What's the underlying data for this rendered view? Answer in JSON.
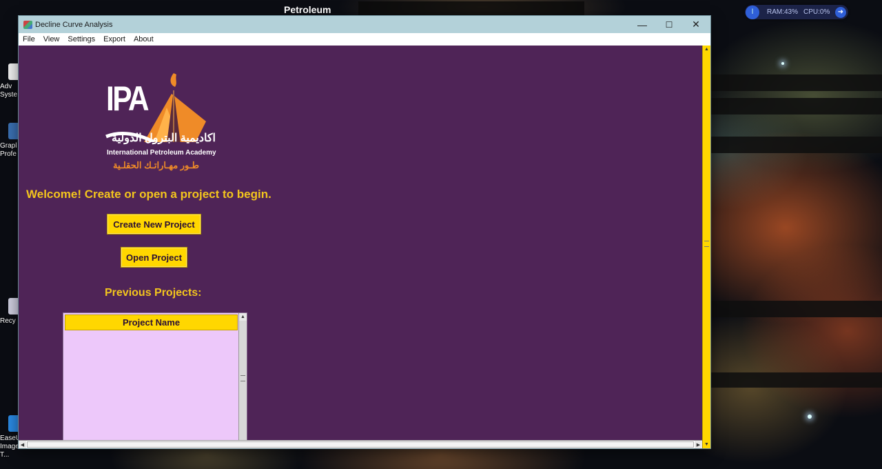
{
  "desktop": {
    "wallpaper_label": "Petroleum",
    "icons": [
      {
        "label": "Adv Syste"
      },
      {
        "label": "Grapl Profe"
      },
      {
        "label": "Recy"
      },
      {
        "label": "EaseUS Image T..."
      }
    ],
    "system_monitor": {
      "ram": "RAM:43%",
      "cpu": "CPU:0%"
    }
  },
  "window": {
    "title": "Decline Curve Analysis",
    "controls": {
      "minimize": "—",
      "maximize": "☐",
      "close": "✕"
    }
  },
  "menu": [
    "File",
    "View",
    "Settings",
    "Export",
    "About"
  ],
  "logo": {
    "mark": "IPA",
    "arabic_name": "اكاديمية البترول الدولية",
    "english_name": "International Petroleum Academy",
    "arabic_tagline": "طـور مهـاراتـك الحقلـية"
  },
  "welcome_text": "Welcome! Create or open a project to begin.",
  "buttons": {
    "create": "Create New Project",
    "open": "Open Project"
  },
  "previous_projects": {
    "heading": "Previous Projects:",
    "columns": [
      "Project Name"
    ],
    "rows": []
  },
  "colors": {
    "background": "#4f2457",
    "accent": "#ffd700",
    "heading": "#f3c51d",
    "list_background": "#edc8fa",
    "titlebar": "#b3d1d9"
  }
}
